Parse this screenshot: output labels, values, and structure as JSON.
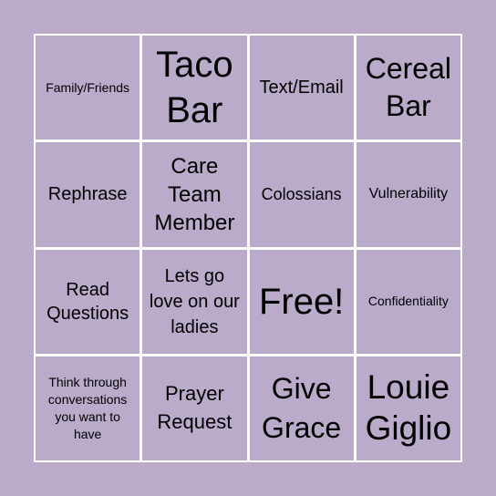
{
  "board": {
    "background_color": "#b9abc9",
    "grid_color": "#ffffff",
    "cells": [
      {
        "text": "Family/Friends"
      },
      {
        "text": "Taco Bar"
      },
      {
        "text": "Text/Email"
      },
      {
        "text": "Cereal Bar"
      },
      {
        "text": "Rephrase"
      },
      {
        "text": "Care Team Member"
      },
      {
        "text": "Colossians"
      },
      {
        "text": "Vulnerability"
      },
      {
        "text": "Read Questions"
      },
      {
        "text": "Lets go love on our ladies"
      },
      {
        "text": "Free!"
      },
      {
        "text": "Confidentiality"
      },
      {
        "text": "Think through conversations you want to have"
      },
      {
        "text": "Prayer Request"
      },
      {
        "text": "Give Grace"
      },
      {
        "text": "Louie Giglio"
      }
    ]
  }
}
